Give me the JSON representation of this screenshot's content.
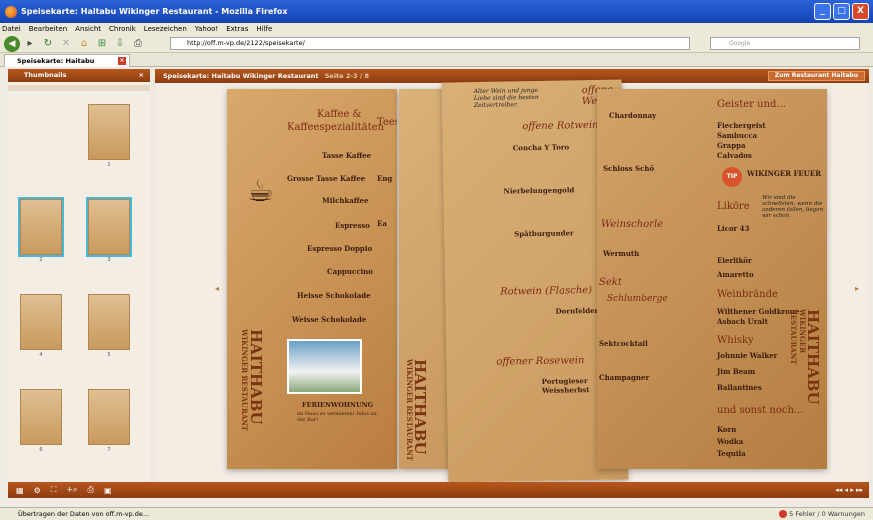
{
  "window": {
    "title": "Speisekarte: Haitabu Wikinger Restaurant - Mozilla Firefox",
    "buttons": [
      "_",
      "□",
      "X"
    ]
  },
  "menu": [
    "Datei",
    "Bearbeiten",
    "Ansicht",
    "Chronik",
    "Lesezeichen",
    "Yahoo!",
    "Extras",
    "Hilfe"
  ],
  "nav": {
    "url": "http://off.m-vp.de/2122/speisekarte/",
    "search_placeholder": "Google"
  },
  "tab": {
    "label": "Speisekarte: Haitabu Wikinger R..."
  },
  "thumbnails": {
    "header": "Thumbnails",
    "close": "×",
    "items": [
      {
        "label": ""
      },
      {
        "label": "1"
      },
      {
        "label": "2"
      },
      {
        "label": "3"
      },
      {
        "label": "4"
      },
      {
        "label": "5"
      },
      {
        "label": "6"
      },
      {
        "label": "7"
      }
    ],
    "selected": [
      "2",
      "3"
    ]
  },
  "viewer": {
    "title": "Speisekarte: Haitabu Wikinger Restaurant",
    "pages": "Seite  2-3 / 8",
    "button": "Zum Restaurant Haitabu"
  },
  "menu_card": {
    "page1": {
      "heading1": "Kaffee &",
      "heading2": "Kaffeespezialitäten",
      "items": [
        "Tasse Kaffee",
        "Grosse Tasse Kaffee",
        "Milchkaffee",
        "Espresso",
        "Espresso Doppio",
        "Cappuccino",
        "Heisse Schokolade",
        "Weisse Schokolade"
      ],
      "vertical": "HAITHABU",
      "vertical2": "WIKINGER RESTAURANT",
      "ad_title": "FERIENWOHNUNG",
      "ad_sub": "im Haus zu vermieten! Infos an der Bar!",
      "partial_heading": "Teesp",
      "partial": [
        "Eng",
        "Ea"
      ]
    },
    "page2": {
      "note": "Alter Wein und junge Liebe sind die besten Zeitvertreiber.",
      "heading": "offene Rotweine",
      "items": [
        "Concha Y Toro",
        "Nierbelungengold",
        "Spätburgunder"
      ],
      "heading2": "Rotwein (Flasche)",
      "items2": [
        "Dornfelder"
      ],
      "heading3": "offener Rosewein",
      "items3": [
        "Portugieser Weissherbst"
      ],
      "vertical": "HAITHABU",
      "vertical2": "WIKINGER RESTAURANT"
    },
    "page3": {
      "heading": "offene Weißwe",
      "items": [
        "Chardonnay",
        "Schloss Schö"
      ],
      "heading2": "Weinschorle",
      "items2": [
        "Wermuth"
      ],
      "heading3": "Sekt",
      "script": "Schlumberge",
      "items3": [
        "Sektcocktail",
        "Champagner"
      ]
    },
    "page4": {
      "heading": "Geister und...",
      "items": [
        "Fiechergeist",
        "Sambucca",
        "Grappa",
        "Calvados"
      ],
      "tip": "TIP",
      "feuer": "WIKINGER FEUER",
      "script_note": "Wir sind die schnellsten, wenn die anderen fallen, liegen wir schon.",
      "heading2": "Liköre",
      "items2": [
        "Licor 43",
        "Eierlikör",
        "Amaretto"
      ],
      "heading3": "Weinbrände",
      "items3": [
        "Wilthener Goldkrone",
        "Asbach Uralt"
      ],
      "heading4": "Whisky",
      "items4": [
        "Johnnie Walker",
        "Jim Beam",
        "Ballantines"
      ],
      "heading5": "und sonst noch...",
      "items5": [
        "Korn",
        "Wodka",
        "Tequila"
      ],
      "vertical": "HAITHABU",
      "vertical2": "WIKINGER RESTAURANT"
    }
  },
  "status": {
    "left": "Übertragen der Daten von off.m-vp.de...",
    "right": "5 Fehler / 0 Warnungen"
  },
  "bottom_nav": "◂◂ ◂ ▸ ▸▸"
}
